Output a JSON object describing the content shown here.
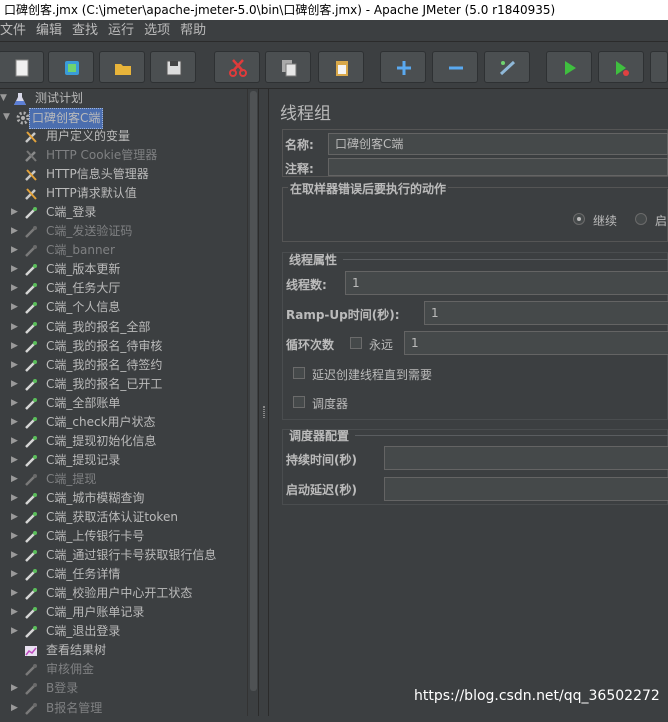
{
  "window": {
    "title": "口碑创客.jmx (C:\\jmeter\\apache-jmeter-5.0\\bin\\口碑创客.jmx) - Apache JMeter (5.0 r1840935)"
  },
  "menu": [
    "文件",
    "编辑",
    "查找",
    "运行",
    "选项",
    "帮助"
  ],
  "toolbar": [
    {
      "name": "new-icon",
      "color": "#f0f0f0"
    },
    {
      "name": "templates-icon",
      "color": "#3a9bd8"
    },
    {
      "name": "open-icon",
      "color": "#e8b43a"
    },
    {
      "name": "save-icon",
      "color": "#dcdcdc"
    },
    {
      "name": "cut-icon",
      "color": "#e03b3b"
    },
    {
      "name": "copy-icon",
      "color": "#e6e6e6"
    },
    {
      "name": "paste-icon",
      "color": "#d8a84a"
    },
    {
      "name": "expand-icon",
      "color": "#5aa9f0"
    },
    {
      "name": "collapse-icon",
      "color": "#5aa9f0"
    },
    {
      "name": "toggle-icon",
      "color": "#8fb8d8"
    },
    {
      "name": "start-icon",
      "color": "#3fbf3f"
    },
    {
      "name": "start-no-pause-icon",
      "color": "#3fbf3f"
    },
    {
      "name": "stop-icon",
      "color": "#8a8a8a"
    }
  ],
  "tree": {
    "root": "测试计划",
    "selected": "口碑创客C端",
    "children": [
      {
        "label": "用户定义的变量",
        "type": "config",
        "disabled": false
      },
      {
        "label": "HTTP Cookie管理器",
        "type": "config",
        "disabled": true
      },
      {
        "label": "HTTP信息头管理器",
        "type": "config",
        "disabled": false
      },
      {
        "label": "HTTP请求默认值",
        "type": "config",
        "disabled": false
      },
      {
        "label": "C端_登录",
        "type": "sampler",
        "disabled": false
      },
      {
        "label": "C端_发送验证码",
        "type": "sampler",
        "disabled": true
      },
      {
        "label": "C端_banner",
        "type": "sampler",
        "disabled": true
      },
      {
        "label": "C端_版本更新",
        "type": "sampler",
        "disabled": false
      },
      {
        "label": "C端_任务大厅",
        "type": "sampler",
        "disabled": false
      },
      {
        "label": "C端_个人信息",
        "type": "sampler",
        "disabled": false
      },
      {
        "label": "C端_我的报名_全部",
        "type": "sampler",
        "disabled": false
      },
      {
        "label": "C端_我的报名_待审核",
        "type": "sampler",
        "disabled": false
      },
      {
        "label": "C端_我的报名_待签约",
        "type": "sampler",
        "disabled": false
      },
      {
        "label": "C端_我的报名_已开工",
        "type": "sampler",
        "disabled": false
      },
      {
        "label": "C端_全部账单",
        "type": "sampler",
        "disabled": false
      },
      {
        "label": "C端_check用户状态",
        "type": "sampler",
        "disabled": false
      },
      {
        "label": "C端_提现初始化信息",
        "type": "sampler",
        "disabled": false
      },
      {
        "label": "C端_提现记录",
        "type": "sampler",
        "disabled": false
      },
      {
        "label": "C端_提现",
        "type": "sampler",
        "disabled": true
      },
      {
        "label": "C端_城市模糊查询",
        "type": "sampler",
        "disabled": false
      },
      {
        "label": "C端_获取活体认证token",
        "type": "sampler",
        "disabled": false
      },
      {
        "label": "C端_上传银行卡号",
        "type": "sampler",
        "disabled": false
      },
      {
        "label": "C端_通过银行卡号获取银行信息",
        "type": "sampler",
        "disabled": false
      },
      {
        "label": "C端_任务详情",
        "type": "sampler",
        "disabled": false
      },
      {
        "label": "C端_校验用户中心开工状态",
        "type": "sampler",
        "disabled": false
      },
      {
        "label": "C端_用户账单记录",
        "type": "sampler",
        "disabled": false
      },
      {
        "label": "C端_退出登录",
        "type": "sampler",
        "disabled": false
      },
      {
        "label": "查看结果树",
        "type": "listener",
        "disabled": false
      }
    ],
    "after": [
      {
        "label": "审核佣金",
        "type": "group",
        "disabled": true
      },
      {
        "label": "B登录",
        "type": "group",
        "disabled": true
      },
      {
        "label": "B报名管理",
        "type": "group",
        "disabled": true
      }
    ]
  },
  "panel": {
    "title": "线程组",
    "name_label": "名称:",
    "name_value": "口碑创客C端",
    "comment_label": "注释:",
    "comment_value": "",
    "error_section": "在取样器错误后要执行的动作",
    "radio_continue": "继续",
    "radio_next_partial": "启",
    "thread_section": "线程属性",
    "threads_label": "线程数:",
    "threads_value": "1",
    "rampup_label": "Ramp-Up时间(秒):",
    "rampup_value": "1",
    "loop_label": "循环次数",
    "forever_label": "永远",
    "loop_value": "1",
    "delay_label": "延迟创建线程直到需要",
    "scheduler_label": "调度器",
    "sched_section": "调度器配置",
    "duration_label": "持续时间(秒)",
    "duration_value": "",
    "startup_delay_label": "启动延迟(秒)",
    "startup_delay_value": ""
  },
  "watermark": "https://blog.csdn.net/qq_36502272"
}
